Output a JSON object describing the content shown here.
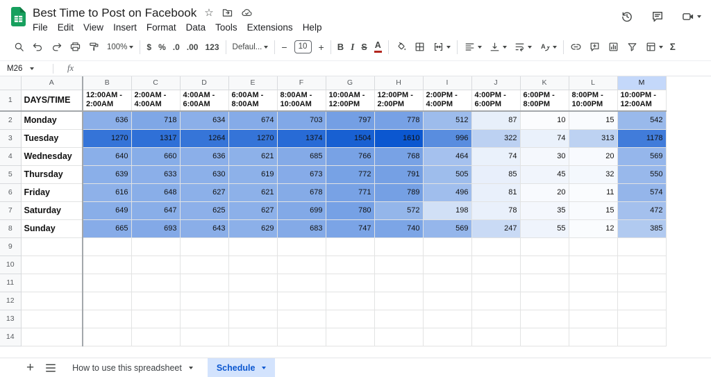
{
  "titlebar": {
    "title": "Best Time to Post on Facebook",
    "menus": [
      "File",
      "Edit",
      "View",
      "Insert",
      "Format",
      "Data",
      "Tools",
      "Extensions",
      "Help"
    ]
  },
  "toolbar": {
    "items": [
      {
        "type": "icon",
        "name": "search"
      },
      {
        "type": "icon",
        "name": "undo"
      },
      {
        "type": "icon",
        "name": "redo"
      },
      {
        "type": "icon",
        "name": "print"
      },
      {
        "type": "icon",
        "name": "paint-format"
      },
      {
        "type": "select",
        "name": "zoom",
        "value": "100%"
      },
      {
        "type": "sep"
      },
      {
        "type": "text",
        "name": "format-currency",
        "label": "$"
      },
      {
        "type": "text",
        "name": "format-percent",
        "label": "%"
      },
      {
        "type": "text",
        "name": "decrease-decimal-places",
        "label": ".0"
      },
      {
        "type": "text",
        "name": "increase-decimal-places",
        "label": ".00"
      },
      {
        "type": "text",
        "name": "more-formats",
        "label": "123"
      },
      {
        "type": "sep"
      },
      {
        "type": "select",
        "name": "font-family",
        "value": "Defaul..."
      },
      {
        "type": "sep"
      },
      {
        "type": "text",
        "name": "decrease-font-size",
        "label": "−"
      },
      {
        "type": "box",
        "name": "font-size",
        "value": "10"
      },
      {
        "type": "text",
        "name": "increase-font-size",
        "label": "+"
      },
      {
        "type": "sep"
      },
      {
        "type": "text",
        "name": "bold",
        "label": "B"
      },
      {
        "type": "text",
        "name": "italic",
        "label": "I"
      },
      {
        "type": "text",
        "name": "strikethrough",
        "label": "S"
      },
      {
        "type": "text",
        "name": "text-color",
        "label": "A"
      },
      {
        "type": "sep"
      },
      {
        "type": "icon",
        "name": "fill-color"
      },
      {
        "type": "icon",
        "name": "borders"
      },
      {
        "type": "icon",
        "name": "merge-cells",
        "caret": true
      },
      {
        "type": "sep"
      },
      {
        "type": "icon",
        "name": "horizontal-align",
        "caret": true
      },
      {
        "type": "icon",
        "name": "vertical-align",
        "caret": true
      },
      {
        "type": "icon",
        "name": "text-wrap",
        "caret": true
      },
      {
        "type": "icon",
        "name": "text-rotation",
        "caret": true
      },
      {
        "type": "sep"
      },
      {
        "type": "icon",
        "name": "insert-link"
      },
      {
        "type": "icon",
        "name": "insert-comment"
      },
      {
        "type": "icon",
        "name": "insert-chart"
      },
      {
        "type": "icon",
        "name": "create-filter"
      },
      {
        "type": "icon",
        "name": "table-views",
        "caret": true
      },
      {
        "type": "text",
        "name": "functions",
        "label": "Σ"
      }
    ]
  },
  "formula_bar": {
    "name_box": "M26",
    "fx": "fx"
  },
  "sheet": {
    "columns": [
      "A",
      "B",
      "C",
      "D",
      "E",
      "F",
      "G",
      "H",
      "I",
      "J",
      "K",
      "L",
      "M"
    ],
    "selected_column": "M",
    "row_count": 14,
    "header_row": {
      "a": "DAYS/TIME",
      "times": [
        "12:00AM - 2:00AM",
        "2:00AM - 4:00AM",
        "4:00AM - 6:00AM",
        "6:00AM - 8:00AM",
        "8:00AM - 10:00AM",
        "10:00AM - 12:00PM",
        "12:00PM - 2:00PM",
        "2:00PM - 4:00PM",
        "4:00PM - 6:00PM",
        "6:00PM - 8:00PM",
        "8:00PM - 10:00PM",
        "10:00PM - 12:00AM"
      ]
    },
    "days": [
      "Monday",
      "Tuesday",
      "Wednesday",
      "Thursday",
      "Friday",
      "Saturday",
      "Sunday"
    ],
    "values": [
      [
        636,
        718,
        634,
        674,
        703,
        797,
        778,
        512,
        87,
        10,
        15,
        542
      ],
      [
        1270,
        1317,
        1264,
        1270,
        1374,
        1504,
        1610,
        996,
        322,
        74,
        313,
        1178
      ],
      [
        640,
        660,
        636,
        621,
        685,
        766,
        768,
        464,
        74,
        30,
        20,
        569
      ],
      [
        639,
        633,
        630,
        619,
        673,
        772,
        791,
        505,
        85,
        45,
        32,
        550
      ],
      [
        616,
        648,
        627,
        621,
        678,
        771,
        789,
        496,
        81,
        20,
        11,
        574
      ],
      [
        649,
        647,
        625,
        627,
        699,
        780,
        572,
        198,
        78,
        35,
        15,
        472
      ],
      [
        665,
        693,
        643,
        629,
        683,
        747,
        740,
        569,
        247,
        55,
        12,
        385
      ]
    ]
  },
  "heatmap": {
    "min_color": "#ffffff",
    "max_color": "#0b57d0",
    "max_value": 1610
  },
  "sheetbar": {
    "add_label": "+",
    "tabs": [
      {
        "label": "How to use this spreadsheet",
        "active": false
      },
      {
        "label": "Schedule",
        "active": true
      }
    ]
  }
}
